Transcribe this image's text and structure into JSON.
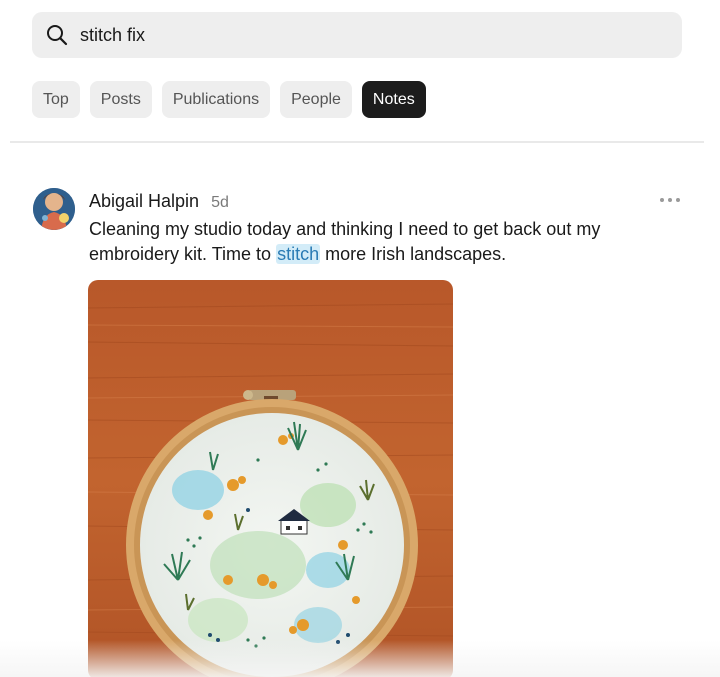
{
  "search": {
    "value": "stitch fix",
    "icon": "search-icon"
  },
  "tabs": [
    {
      "label": "Top",
      "active": false
    },
    {
      "label": "Posts",
      "active": false
    },
    {
      "label": "Publications",
      "active": false
    },
    {
      "label": "People",
      "active": false
    },
    {
      "label": "Notes",
      "active": true
    }
  ],
  "note": {
    "author": "Abigail Halpin",
    "time": "5d",
    "text_before": "Cleaning my studio today and thinking I need to get back out my embroidery kit. Time to ",
    "text_highlight": "stitch",
    "text_after": " more Irish landscapes.",
    "more_icon": "more-horizontal-icon",
    "image_subject": "embroidery hoop with Irish landscape on wooden table"
  },
  "colors": {
    "active_tab_bg": "#1c1c1c",
    "tab_bg": "#eeeeee",
    "highlight_bg": "#d3ecf8",
    "highlight_text": "#2a7bb4"
  }
}
